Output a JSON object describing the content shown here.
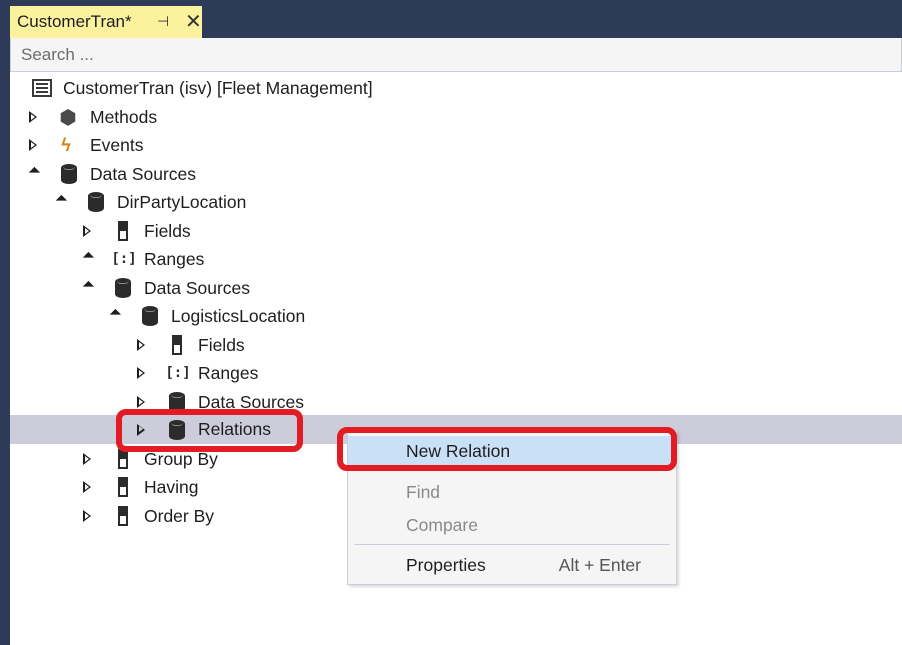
{
  "tab": {
    "title": "CustomerTran*",
    "pin_glyph": "⊣",
    "close_glyph": "✕"
  },
  "search": {
    "placeholder": "Search ..."
  },
  "tree": [
    {
      "label": "CustomerTran (isv) [Fleet Management]",
      "icon": "form-icon",
      "expander": "none"
    },
    {
      "label": "Methods",
      "icon": "methods-icon",
      "expander": "collapsed"
    },
    {
      "label": "Events",
      "icon": "events-bolt-icon",
      "expander": "collapsed"
    },
    {
      "label": "Data Sources",
      "icon": "datasource-icon",
      "expander": "expanded"
    },
    {
      "label": "DirPartyLocation",
      "icon": "datasource-icon",
      "expander": "expanded"
    },
    {
      "label": "Fields",
      "icon": "fields-icon",
      "expander": "collapsed"
    },
    {
      "label": "Ranges",
      "icon": "ranges-icon",
      "expander": "expanded"
    },
    {
      "label": "Data Sources",
      "icon": "datasource-icon",
      "expander": "expanded"
    },
    {
      "label": "LogisticsLocation",
      "icon": "datasource-icon",
      "expander": "expanded"
    },
    {
      "label": "Fields",
      "icon": "fields-icon",
      "expander": "collapsed"
    },
    {
      "label": "Ranges",
      "icon": "ranges-icon",
      "expander": "collapsed"
    },
    {
      "label": "Data Sources",
      "icon": "datasource-icon",
      "expander": "collapsed"
    },
    {
      "label": "Relations",
      "icon": "datasource-icon",
      "expander": "collapsed",
      "selected": true
    },
    {
      "label": "Group By",
      "icon": "fields-icon",
      "expander": "collapsed"
    },
    {
      "label": "Having",
      "icon": "fields-icon",
      "expander": "collapsed"
    },
    {
      "label": "Order By",
      "icon": "fields-icon",
      "expander": "collapsed"
    }
  ],
  "context_menu": {
    "items": [
      {
        "label": "New Relation",
        "shortcut": "",
        "enabled": true,
        "highlighted": true
      },
      {
        "label": "Find",
        "shortcut": "",
        "enabled": false
      },
      {
        "label": "Compare",
        "shortcut": "",
        "enabled": false
      },
      {
        "label": "Properties",
        "shortcut": "Alt + Enter",
        "enabled": true
      }
    ]
  },
  "colors": {
    "background": "#2d3b59",
    "tab_active": "#fcf29d",
    "selection": "#ccccdb",
    "menu_highlight": "#c9e0f7",
    "annotation_red": "#e31b23",
    "event_bolt": "#d18616"
  }
}
